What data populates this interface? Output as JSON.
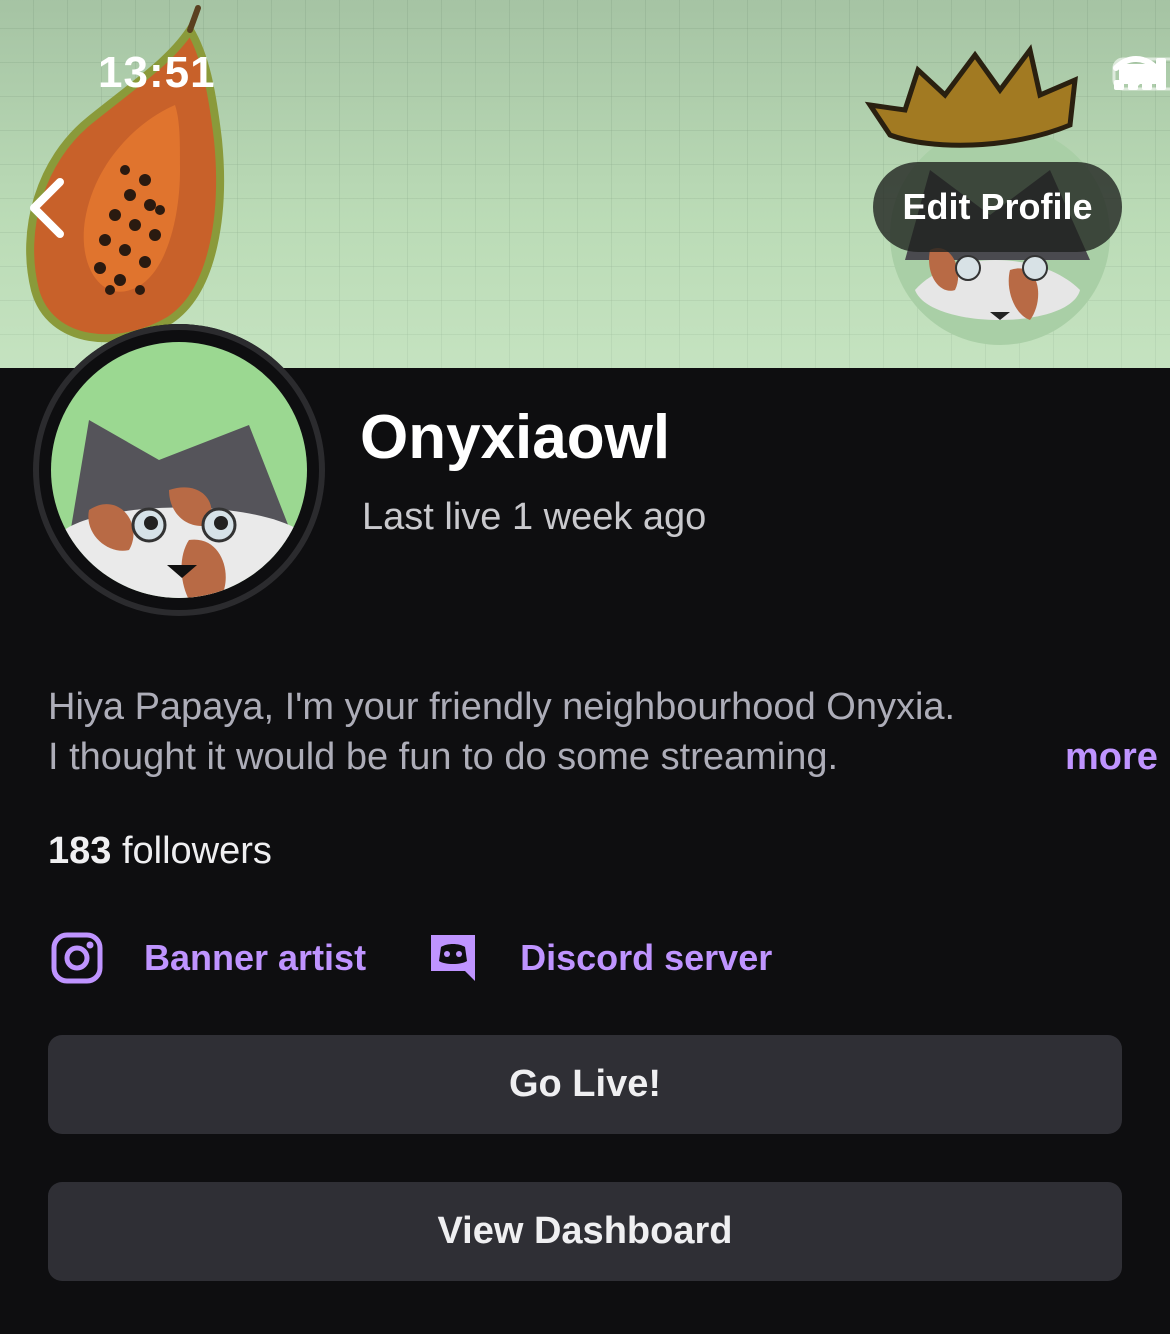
{
  "status_bar": {
    "time": "13:51"
  },
  "banner": {
    "edit_profile_label": "Edit Profile"
  },
  "profile": {
    "username": "Onyxiaowl",
    "last_live": "Last live 1 week ago",
    "bio_line1": "Hiya Papaya, I'm your friendly neighbourhood Onyxia.",
    "bio_line2": "I thought it would be fun to do some streaming.",
    "more_label": "more",
    "followers_count": "183",
    "followers_label": "followers"
  },
  "links": [
    {
      "icon": "instagram-icon",
      "label": "Banner artist"
    },
    {
      "icon": "discord-icon",
      "label": "Discord server"
    }
  ],
  "actions": {
    "go_live_label": "Go Live!",
    "dashboard_label": "View Dashboard"
  },
  "colors": {
    "accent": "#bf94ff",
    "background": "#0e0e10",
    "button_bg": "#2f2f35"
  }
}
